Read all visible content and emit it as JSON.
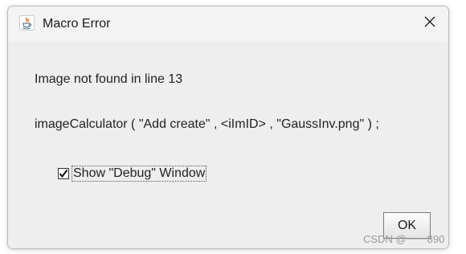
{
  "window": {
    "title": "Macro Error",
    "app_icon": "java-icon",
    "close_icon": "close-icon"
  },
  "message": {
    "line1": "Image not found in line 13",
    "line2": "imageCalculator ( \"Add create\" , <iImID> , \"GaussInv.png\" ) ;"
  },
  "checkbox": {
    "label": "Show \"Debug\" Window",
    "checked": true
  },
  "buttons": {
    "ok_label": "OK"
  },
  "watermark": {
    "text": "CSDN @一一890"
  },
  "colors": {
    "dialog_bg": "#f0f0f0",
    "titlebar_bg": "#f3f3f3",
    "text": "#222222"
  }
}
